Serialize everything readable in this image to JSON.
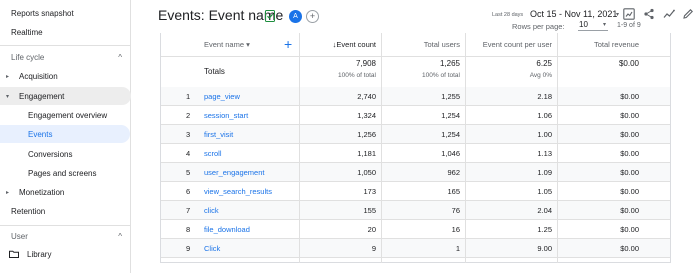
{
  "sidebar": {
    "reports_snapshot": "Reports snapshot",
    "realtime": "Realtime",
    "lifecycle_heading": "Life cycle",
    "acquisition": "Acquisition",
    "engagement": "Engagement",
    "engagement_overview": "Engagement overview",
    "events": "Events",
    "conversions": "Conversions",
    "pages_and_screens": "Pages and screens",
    "monetization": "Monetization",
    "retention": "Retention",
    "user_heading": "User",
    "library": "Library",
    "arrow_collapsed": "▸",
    "arrow_expanded": "▾",
    "collapse_glyph": "^"
  },
  "header": {
    "title": "Events: Event name",
    "avatar_letter": "A",
    "add_comparison_glyph": "+",
    "date_preset": "Last 28 days",
    "date_range": "Oct 15 - Nov 11, 2021",
    "date_caret": "▾",
    "rows_per_page_label": "Rows per page:",
    "rows_per_page_value": "10",
    "rows_caret": "▾",
    "pagination": "1-9 of 9"
  },
  "table": {
    "headers": {
      "event_name": "Event name ▾",
      "add": "+",
      "event_count": "↓Event count",
      "total_users": "Total users",
      "per_user": "Event count per user",
      "revenue": "Total revenue"
    },
    "totals": {
      "label": "Totals",
      "event_count": "7,908",
      "event_count_sub": "100% of total",
      "total_users": "1,265",
      "total_users_sub": "100% of total",
      "per_user": "6.25",
      "per_user_sub": "Avg 0%",
      "revenue": "$0.00"
    },
    "rows": [
      {
        "idx": "1",
        "name": "page_view",
        "count": "2,740",
        "users": "1,255",
        "per_user": "2.18",
        "revenue": "$0.00"
      },
      {
        "idx": "2",
        "name": "session_start",
        "count": "1,324",
        "users": "1,254",
        "per_user": "1.06",
        "revenue": "$0.00"
      },
      {
        "idx": "3",
        "name": "first_visit",
        "count": "1,256",
        "users": "1,254",
        "per_user": "1.00",
        "revenue": "$0.00"
      },
      {
        "idx": "4",
        "name": "scroll",
        "count": "1,181",
        "users": "1,046",
        "per_user": "1.13",
        "revenue": "$0.00"
      },
      {
        "idx": "5",
        "name": "user_engagement",
        "count": "1,050",
        "users": "962",
        "per_user": "1.09",
        "revenue": "$0.00"
      },
      {
        "idx": "6",
        "name": "view_search_results",
        "count": "173",
        "users": "165",
        "per_user": "1.05",
        "revenue": "$0.00"
      },
      {
        "idx": "7",
        "name": "click",
        "count": "155",
        "users": "76",
        "per_user": "2.04",
        "revenue": "$0.00"
      },
      {
        "idx": "8",
        "name": "file_download",
        "count": "20",
        "users": "16",
        "per_user": "1.25",
        "revenue": "$0.00"
      },
      {
        "idx": "9",
        "name": "Click",
        "count": "9",
        "users": "1",
        "per_user": "9.00",
        "revenue": "$0.00"
      }
    ]
  },
  "colors": {
    "accent": "#1a73e8",
    "selected_bg": "#e8f0fe",
    "hover_bg": "#ededed",
    "alt_row_bg": "#f8f9fa",
    "check_green": "#1e8e3e"
  },
  "icons": [
    "check-doc-icon",
    "folder-icon",
    "compare-icon",
    "share-icon",
    "insights-icon",
    "edit-icon"
  ]
}
